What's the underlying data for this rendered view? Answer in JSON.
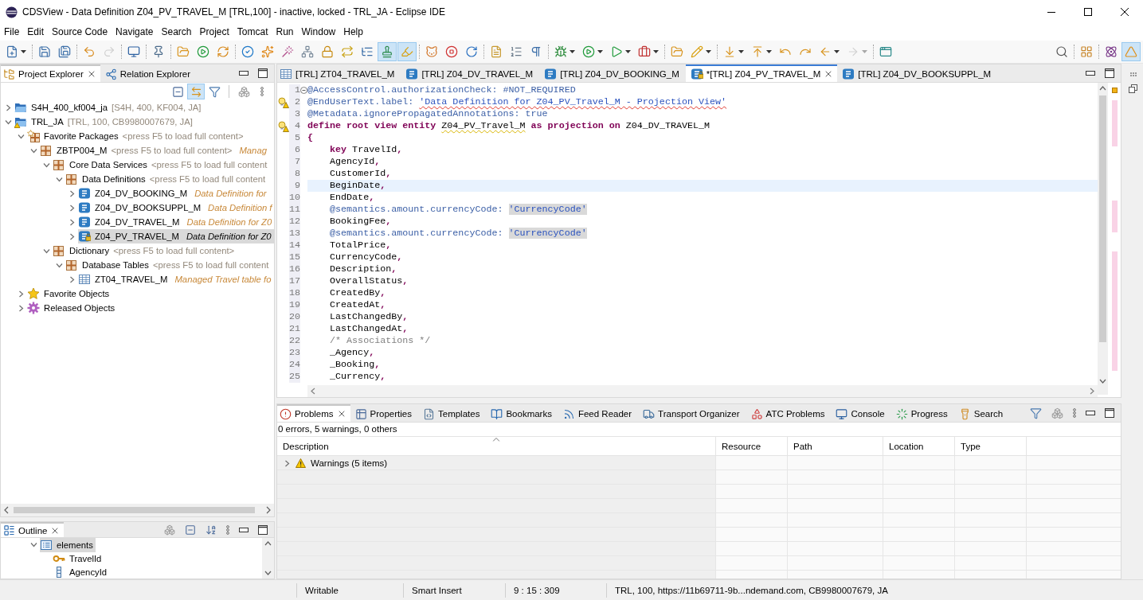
{
  "window": {
    "title": "CDSView - Data Definition Z04_PV_TRAVEL_M [TRL,100] - inactive, locked - TRL_JA - Eclipse IDE"
  },
  "menu": [
    "File",
    "Edit",
    "Source Code",
    "Navigate",
    "Search",
    "Project",
    "Tomcat",
    "Run",
    "Window",
    "Help"
  ],
  "toolbar": {
    "groups": [
      [
        {
          "pressed": false,
          "dropdown": true,
          "disabled": false
        }
      ],
      [
        {
          "pressed": false,
          "dropdown": false,
          "disabled": false
        },
        {
          "pressed": false,
          "dropdown": false,
          "disabled": false
        }
      ],
      [
        {
          "pressed": false,
          "dropdown": false,
          "disabled": false
        },
        {
          "pressed": false,
          "dropdown": false,
          "disabled": true
        }
      ],
      [
        {
          "pressed": false,
          "dropdown": false,
          "disabled": false
        }
      ],
      [
        {
          "pressed": false,
          "dropdown": false,
          "disabled": false
        }
      ],
      [
        {
          "pressed": false,
          "dropdown": false,
          "disabled": false
        },
        {
          "pressed": false,
          "dropdown": false,
          "disabled": false
        },
        {
          "pressed": false,
          "dropdown": false,
          "disabled": false
        }
      ],
      [
        {
          "pressed": false,
          "dropdown": false,
          "disabled": false
        },
        {
          "pressed": false,
          "dropdown": false,
          "disabled": false
        },
        {
          "pressed": false,
          "dropdown": false,
          "disabled": false
        },
        {
          "pressed": false,
          "dropdown": false,
          "disabled": false
        },
        {
          "pressed": false,
          "dropdown": false,
          "disabled": false
        },
        {
          "pressed": false,
          "dropdown": false,
          "disabled": false
        },
        {
          "pressed": false,
          "dropdown": false,
          "disabled": false
        },
        {
          "pressed": true,
          "dropdown": false,
          "disabled": false
        },
        {
          "pressed": true,
          "dropdown": false,
          "disabled": false
        }
      ],
      [
        {
          "pressed": false,
          "dropdown": false,
          "disabled": false
        },
        {
          "pressed": false,
          "dropdown": false,
          "disabled": false
        },
        {
          "pressed": false,
          "dropdown": false,
          "disabled": false
        }
      ],
      [
        {
          "pressed": false,
          "dropdown": false,
          "disabled": false
        },
        {
          "pressed": false,
          "dropdown": false,
          "disabled": false
        },
        {
          "pressed": false,
          "dropdown": false,
          "disabled": false
        }
      ],
      [
        {
          "pressed": false,
          "dropdown": true,
          "disabled": false
        },
        {
          "pressed": false,
          "dropdown": true,
          "disabled": false
        },
        {
          "pressed": false,
          "dropdown": true,
          "disabled": false
        },
        {
          "pressed": false,
          "dropdown": true,
          "disabled": false
        }
      ],
      [
        {
          "pressed": false,
          "dropdown": false,
          "disabled": false
        },
        {
          "pressed": false,
          "dropdown": true,
          "disabled": false
        }
      ],
      [
        {
          "pressed": false,
          "dropdown": true,
          "disabled": false
        },
        {
          "pressed": false,
          "dropdown": true,
          "disabled": false
        },
        {
          "pressed": false,
          "dropdown": false,
          "disabled": false
        },
        {
          "pressed": false,
          "dropdown": false,
          "disabled": false
        },
        {
          "pressed": false,
          "dropdown": true,
          "disabled": false
        },
        {
          "pressed": false,
          "dropdown": true,
          "disabled": true
        }
      ],
      [
        {
          "pressed": false,
          "dropdown": false,
          "disabled": false
        }
      ]
    ],
    "right_groups": [
      [
        {
          "pressed": false,
          "dropdown": false,
          "disabled": false
        }
      ],
      [
        {
          "pressed": false,
          "dropdown": false,
          "disabled": false
        }
      ],
      [
        {
          "pressed": false,
          "dropdown": false,
          "disabled": false
        },
        {
          "pressed": true,
          "dropdown": false,
          "disabled": false
        }
      ]
    ]
  },
  "project_explorer": {
    "tabs": [
      {
        "label": "Project Explorer",
        "selected": true,
        "closable": true
      },
      {
        "label": "Relation Explorer",
        "selected": false,
        "closable": false
      }
    ],
    "toolbar": [
      {
        "pressed": false
      },
      {
        "pressed": true
      },
      {
        "pressed": false
      },
      {
        "pressed": false
      },
      {
        "pressed": false
      }
    ],
    "tree": [
      {
        "label": "S4H_400_kf004_ja",
        "decoration": "[S4H, 400, KF004, JA]",
        "kind": "project",
        "warning": false,
        "locked": false,
        "expanded": false,
        "selected": false
      },
      {
        "label": "TRL_JA",
        "decoration": "[TRL, 100, CB9980007679, JA]",
        "kind": "project",
        "warning": true,
        "locked": false,
        "expanded": true,
        "selected": false,
        "children": [
          {
            "label": "Favorite Packages",
            "decoration": "<press F5 to load full content>",
            "kind": "favorite_packages",
            "warning": false,
            "locked": false,
            "expanded": true,
            "selected": false,
            "children": [
              {
                "label": "ZBTP004_M",
                "decoration": "<press F5 to load full content>",
                "description": "Manag",
                "kind": "package",
                "warning": false,
                "locked": false,
                "expanded": true,
                "selected": false,
                "children": [
                  {
                    "label": "Core Data Services",
                    "decoration": "<press F5 to load full content",
                    "kind": "package",
                    "warning": false,
                    "locked": false,
                    "expanded": true,
                    "selected": false,
                    "children": [
                      {
                        "label": "Data Definitions",
                        "decoration": "<press F5 to load full content",
                        "kind": "package",
                        "warning": false,
                        "locked": false,
                        "expanded": true,
                        "selected": false,
                        "children": [
                          {
                            "label": "Z04_DV_BOOKING_M",
                            "description": "Data Definition for",
                            "kind": "ddl",
                            "warning": false,
                            "locked": false,
                            "expanded": false,
                            "selected": false
                          },
                          {
                            "label": "Z04_DV_BOOKSUPPL_M",
                            "description": "Data Definition f",
                            "kind": "ddl",
                            "warning": false,
                            "locked": false,
                            "expanded": false,
                            "selected": false
                          },
                          {
                            "label": "Z04_DV_TRAVEL_M",
                            "description": "Data Definition for Z0",
                            "kind": "ddl",
                            "warning": false,
                            "locked": false,
                            "expanded": false,
                            "selected": false
                          },
                          {
                            "label": "Z04_PV_TRAVEL_M",
                            "description": "Data Definition for Z0",
                            "kind": "ddl",
                            "warning": false,
                            "locked": true,
                            "expanded": false,
                            "selected": true
                          }
                        ]
                      }
                    ]
                  },
                  {
                    "label": "Dictionary",
                    "decoration": "<press F5 to load full content>",
                    "kind": "package",
                    "warning": false,
                    "locked": false,
                    "expanded": true,
                    "selected": false,
                    "children": [
                      {
                        "label": "Database Tables",
                        "decoration": "<press F5 to load full content",
                        "kind": "package",
                        "warning": false,
                        "locked": false,
                        "expanded": true,
                        "selected": false,
                        "children": [
                          {
                            "label": "ZT04_TRAVEL_M",
                            "description": "Managed Travel table fo",
                            "kind": "table",
                            "warning": false,
                            "locked": false,
                            "expanded": false,
                            "selected": false
                          }
                        ]
                      }
                    ]
                  }
                ]
              }
            ]
          },
          {
            "label": "Favorite Objects",
            "kind": "favorites",
            "warning": false,
            "locked": false,
            "expanded": false,
            "selected": false
          },
          {
            "label": "Released Objects",
            "kind": "released",
            "warning": false,
            "locked": false,
            "expanded": false,
            "selected": false
          }
        ]
      }
    ]
  },
  "outline": {
    "tabs": [
      {
        "label": "Outline",
        "selected": true,
        "closable": true
      }
    ],
    "tree": [
      {
        "label": "elements",
        "kind": "list",
        "expanded": true,
        "selected": true,
        "children": [
          {
            "label": "TravelId",
            "kind": "key",
            "selected": false
          },
          {
            "label": "AgencyId",
            "kind": "field",
            "selected": false
          }
        ]
      }
    ]
  },
  "editor": {
    "tabs": [
      {
        "label": "[TRL] ZT04_TRAVEL_M",
        "kind": "table",
        "locked": false,
        "selected": false,
        "closable": false
      },
      {
        "label": "[TRL] Z04_DV_TRAVEL_M",
        "kind": "ddl",
        "locked": false,
        "selected": false,
        "closable": false
      },
      {
        "label": "[TRL] Z04_DV_BOOKING_M",
        "kind": "ddl",
        "locked": false,
        "selected": false,
        "closable": false
      },
      {
        "label": "*[TRL] Z04_PV_TRAVEL_M",
        "kind": "ddl",
        "locked": true,
        "selected": true,
        "closable": true
      },
      {
        "label": "[TRL] Z04_DV_BOOKSUPPL_M",
        "kind": "ddl",
        "locked": false,
        "selected": false,
        "closable": false
      }
    ],
    "lines": [
      {
        "number": "1",
        "current": false,
        "warning": false,
        "expanded": true,
        "tokens": [
          {
            "kind": "annotation",
            "text": "@AccessControl.authorizationCheck: #NOT_REQUIRED"
          }
        ]
      },
      {
        "number": "2",
        "current": false,
        "warning": true,
        "tokens": [
          {
            "kind": "annotation",
            "text": "@EndUserText.label: "
          },
          {
            "kind": "misspelled",
            "text": "'Data Definition for Z04_PV_Travel_M - Projection View'"
          }
        ]
      },
      {
        "number": "3",
        "current": false,
        "warning": false,
        "tokens": [
          {
            "kind": "annotation",
            "text": "@Metadata.ignorePropagatedAnnotations: true"
          }
        ]
      },
      {
        "number": "4",
        "current": false,
        "warning": true,
        "tokens": [
          {
            "kind": "keyword",
            "text": "define root view entity "
          },
          {
            "kind": "flagged",
            "text": "Z04_PV_Travel_M"
          },
          {
            "kind": "keyword",
            "text": " as projection on "
          },
          {
            "kind": "plain",
            "text": "Z04_DV_TRAVEL_M"
          }
        ]
      },
      {
        "number": "5",
        "current": false,
        "warning": false,
        "tokens": [
          {
            "kind": "punct",
            "text": "{"
          }
        ]
      },
      {
        "number": "6",
        "current": false,
        "warning": false,
        "tokens": [
          {
            "kind": "keyword",
            "text": "    key"
          },
          {
            "kind": "plain",
            "text": " TravelId"
          },
          {
            "kind": "punct",
            "text": ","
          }
        ]
      },
      {
        "number": "7",
        "current": false,
        "warning": false,
        "tokens": [
          {
            "kind": "plain",
            "text": "    AgencyId"
          },
          {
            "kind": "punct",
            "text": ","
          }
        ]
      },
      {
        "number": "8",
        "current": false,
        "warning": false,
        "tokens": [
          {
            "kind": "plain",
            "text": "    CustomerId"
          },
          {
            "kind": "punct",
            "text": ","
          }
        ]
      },
      {
        "number": "9",
        "current": true,
        "warning": false,
        "tokens": [
          {
            "kind": "plain",
            "text": "    BeginDate"
          },
          {
            "kind": "punct",
            "text": ","
          }
        ]
      },
      {
        "number": "10",
        "current": false,
        "warning": false,
        "tokens": [
          {
            "kind": "plain",
            "text": "    EndDate"
          },
          {
            "kind": "punct",
            "text": ","
          }
        ]
      },
      {
        "number": "11",
        "current": false,
        "warning": false,
        "tokens": [
          {
            "kind": "annotation",
            "text": "    @semantics.amount.currencyCode: "
          },
          {
            "kind": "occurrence",
            "text": "'CurrencyCode'"
          }
        ]
      },
      {
        "number": "12",
        "current": false,
        "warning": false,
        "tokens": [
          {
            "kind": "plain",
            "text": "    BookingFee"
          },
          {
            "kind": "punct",
            "text": ","
          }
        ]
      },
      {
        "number": "13",
        "current": false,
        "warning": false,
        "tokens": [
          {
            "kind": "annotation",
            "text": "    @semantics.amount.currencyCode: "
          },
          {
            "kind": "occurrence",
            "text": "'CurrencyCode'"
          }
        ]
      },
      {
        "number": "14",
        "current": false,
        "warning": false,
        "tokens": [
          {
            "kind": "plain",
            "text": "    TotalPrice"
          },
          {
            "kind": "punct",
            "text": ","
          }
        ]
      },
      {
        "number": "15",
        "current": false,
        "warning": false,
        "tokens": [
          {
            "kind": "plain",
            "text": "    CurrencyCode"
          },
          {
            "kind": "punct",
            "text": ","
          }
        ]
      },
      {
        "number": "16",
        "current": false,
        "warning": false,
        "tokens": [
          {
            "kind": "plain",
            "text": "    Description"
          },
          {
            "kind": "punct",
            "text": ","
          }
        ]
      },
      {
        "number": "17",
        "current": false,
        "warning": false,
        "tokens": [
          {
            "kind": "plain",
            "text": "    OverallStatus"
          },
          {
            "kind": "punct",
            "text": ","
          }
        ]
      },
      {
        "number": "18",
        "current": false,
        "warning": false,
        "tokens": [
          {
            "kind": "plain",
            "text": "    CreatedBy"
          },
          {
            "kind": "punct",
            "text": ","
          }
        ]
      },
      {
        "number": "19",
        "current": false,
        "warning": false,
        "tokens": [
          {
            "kind": "plain",
            "text": "    CreatedAt"
          },
          {
            "kind": "punct",
            "text": ","
          }
        ]
      },
      {
        "number": "20",
        "current": false,
        "warning": false,
        "tokens": [
          {
            "kind": "plain",
            "text": "    LastChangedBy"
          },
          {
            "kind": "punct",
            "text": ","
          }
        ]
      },
      {
        "number": "21",
        "current": false,
        "warning": false,
        "tokens": [
          {
            "kind": "plain",
            "text": "    LastChangedAt"
          },
          {
            "kind": "punct",
            "text": ","
          }
        ]
      },
      {
        "number": "22",
        "current": false,
        "warning": false,
        "tokens": [
          {
            "kind": "comment",
            "text": "    /* Associations */"
          }
        ]
      },
      {
        "number": "23",
        "current": false,
        "warning": false,
        "tokens": [
          {
            "kind": "plain",
            "text": "    _Agency"
          },
          {
            "kind": "punct",
            "text": ","
          }
        ]
      },
      {
        "number": "24",
        "current": false,
        "warning": false,
        "tokens": [
          {
            "kind": "plain",
            "text": "    _Booking"
          },
          {
            "kind": "punct",
            "text": ","
          }
        ]
      },
      {
        "number": "25",
        "current": false,
        "warning": false,
        "tokens": [
          {
            "kind": "plain",
            "text": "    _Currency"
          },
          {
            "kind": "punct",
            "text": ","
          }
        ]
      }
    ]
  },
  "bottom_panel": {
    "tabs": [
      {
        "label": "Problems",
        "selected": true,
        "closable": true
      },
      {
        "label": "Properties",
        "selected": false,
        "closable": false
      },
      {
        "label": "Templates",
        "selected": false,
        "closable": false
      },
      {
        "label": "Bookmarks",
        "selected": false,
        "closable": false
      },
      {
        "label": "Feed Reader",
        "selected": false,
        "closable": false
      },
      {
        "label": "Transport Organizer",
        "selected": false,
        "closable": false
      },
      {
        "label": "ATC Problems",
        "selected": false,
        "closable": false
      },
      {
        "label": "Console",
        "selected": false,
        "closable": false
      },
      {
        "label": "Progress",
        "selected": false,
        "closable": false
      },
      {
        "label": "Search",
        "selected": false,
        "closable": false
      }
    ],
    "summary": "0 errors, 5 warnings, 0 others",
    "table": {
      "columns": [
        {
          "label": "Description",
          "sorted": true
        },
        {
          "label": "Resource",
          "sorted": false
        },
        {
          "label": "Path",
          "sorted": false
        },
        {
          "label": "Location",
          "sorted": false
        },
        {
          "label": "Type",
          "sorted": false
        }
      ],
      "rows": [
        {
          "label": "Warnings (5 items)",
          "kind": "warning",
          "expanded": false
        }
      ]
    }
  },
  "status_bar": {
    "fields": [
      "Writable",
      "Smart Insert",
      "9 : 15 : 309",
      "TRL, 100, https://11b69711-9b...ndemand.com, CB9980007679, JA"
    ]
  }
}
